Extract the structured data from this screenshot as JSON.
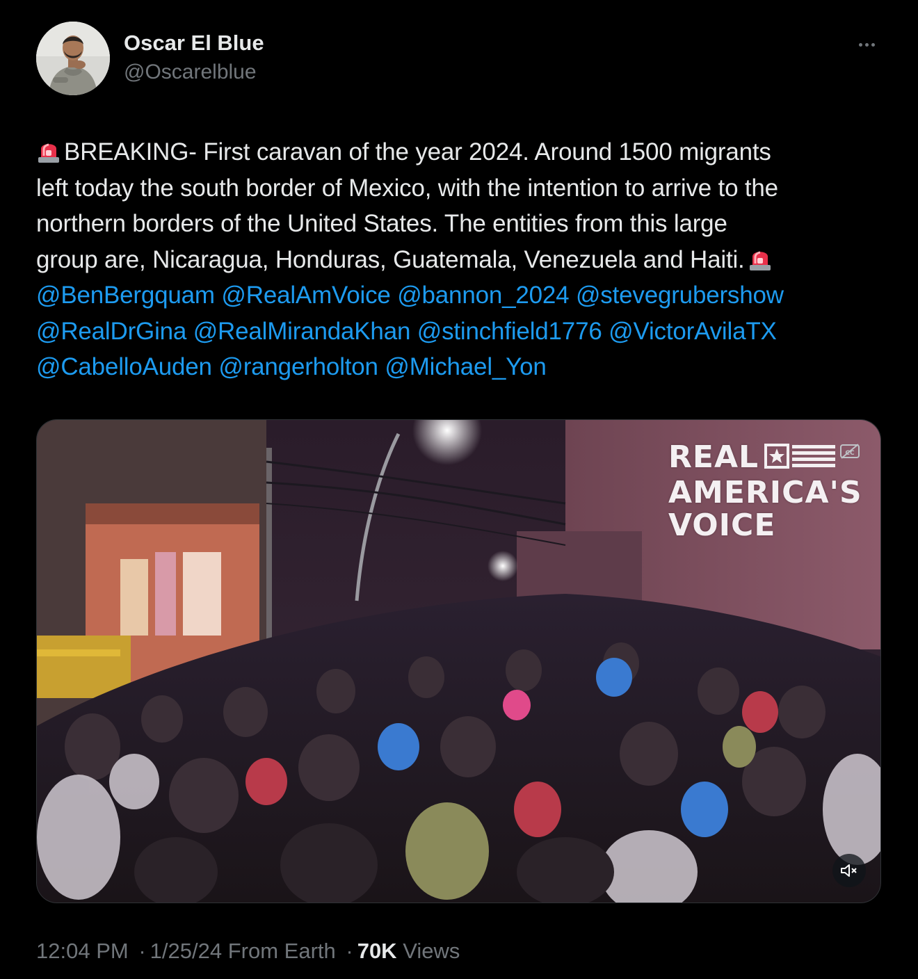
{
  "author": {
    "display_name": "Oscar El Blue",
    "handle": "@Oscarelblue"
  },
  "tweet": {
    "lines": [
      [
        {
          "type": "emoji",
          "name": "rotating-light-emoji"
        },
        {
          "type": "text",
          "text": "BREAKING- First caravan of the year 2024. Around 1500 migrants"
        }
      ],
      [
        {
          "type": "text",
          "text": "left today the south border of Mexico, with the intention to arrive to the"
        }
      ],
      [
        {
          "type": "text",
          "text": "northern borders of the United States. The entities from this large"
        }
      ],
      [
        {
          "type": "text",
          "text": "group are, Nicaragua, Honduras, Guatemala, Venezuela and Haiti."
        },
        {
          "type": "emoji",
          "name": "rotating-light-emoji"
        }
      ],
      [
        {
          "type": "mention",
          "text": "@BenBergquam"
        },
        {
          "type": "mention",
          "text": "@RealAmVoice"
        },
        {
          "type": "mention",
          "text": "@bannon_2024"
        },
        {
          "type": "mention",
          "text": "@stevegrubershow"
        }
      ],
      [
        {
          "type": "mention",
          "text": "@RealDrGina"
        },
        {
          "type": "mention",
          "text": "@RealMirandaKhan"
        },
        {
          "type": "mention",
          "text": "@stinchfield1776"
        },
        {
          "type": "mention",
          "text": "@VictorAvilaTX"
        }
      ],
      [
        {
          "type": "mention",
          "text": "@CabelloAuden"
        },
        {
          "type": "mention",
          "text": "@rangerholton"
        },
        {
          "type": "mention",
          "text": "@Michael_Yon"
        }
      ]
    ]
  },
  "media": {
    "type": "video",
    "watermark_lines": [
      "REAL",
      "AMERICA'S",
      "VOICE"
    ],
    "icons": {
      "captions": "closed-captions-icon",
      "mute": "volume-muted-icon"
    }
  },
  "meta": {
    "time": "12:04 PM",
    "date": "1/25/24",
    "source": "From Earth",
    "views_count": "70K",
    "views_label": "Views",
    "separator": "·"
  },
  "colors": {
    "background": "#000000",
    "text": "#e7e9ea",
    "secondary": "#71767b",
    "link": "#1d9bf0"
  }
}
